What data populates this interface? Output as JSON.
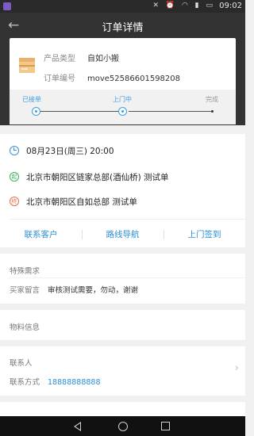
{
  "status_bar": {
    "time": "09:02",
    "icons": [
      "signal-mute-icon",
      "alarm-icon",
      "wifi-icon",
      "cell-signal-icon",
      "battery-icon"
    ]
  },
  "header": {
    "title": "订单详情",
    "back_icon": "back-arrow-icon"
  },
  "order": {
    "product_type_label": "产品类型",
    "product_type": "自如小搬",
    "order_no_label": "订单编号",
    "order_no": "move52586601598208"
  },
  "progress": {
    "steps": [
      {
        "label": "已接单",
        "state": "done"
      },
      {
        "label": "上门中",
        "state": "current"
      },
      {
        "label": "完成",
        "state": "pending"
      }
    ],
    "active_color": "#3aa0e0"
  },
  "schedule": {
    "time": "08月23日(周三)  20:00",
    "start_tag": "起",
    "start_address": "北京市朝阳区链家总部(酒仙桥)  测试单",
    "end_tag": "终",
    "end_address": "北京市朝阳区自如总部  测试单"
  },
  "actions": {
    "contact": "联系客户",
    "navigate": "路线导航",
    "checkin": "上门签到"
  },
  "requirements": {
    "title": "特殊需求",
    "buyer_note_label": "买家留言",
    "buyer_note": "审核测试需要，勿动，谢谢"
  },
  "materials": {
    "title": "物料信息"
  },
  "contact": {
    "person_label": "联系人",
    "method_label": "联系方式",
    "phone": "18888888888"
  },
  "colors": {
    "accent": "#2a8fd8",
    "header_bg": "#333333",
    "page_bg": "#f0f0f0"
  }
}
